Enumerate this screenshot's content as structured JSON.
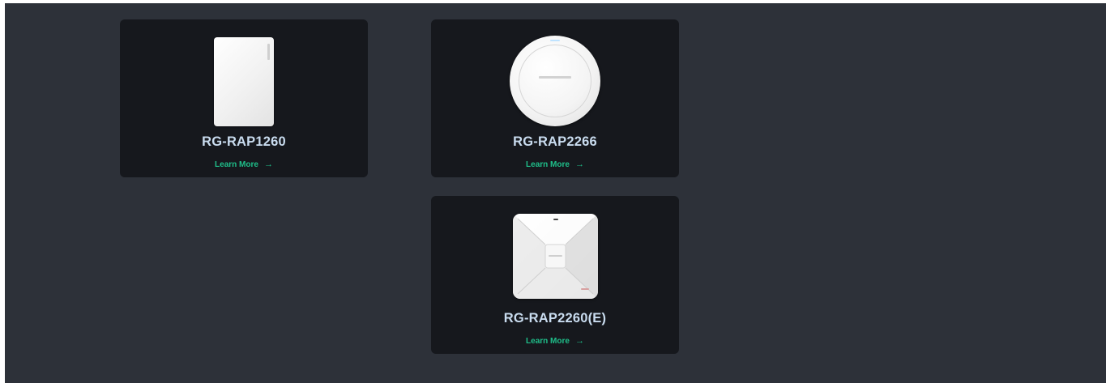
{
  "products": [
    {
      "name": "RG-RAP1260",
      "link_label": "Learn More",
      "arrow": "→",
      "image_icon": "rectangular-panel-ap"
    },
    {
      "name": "RG-RAP2266",
      "link_label": "Learn More",
      "arrow": "→",
      "image_icon": "round-ceiling-ap"
    },
    {
      "name": "RG-RAP2260(E)",
      "link_label": "Learn More",
      "arrow": "→",
      "image_icon": "square-ceiling-ap"
    }
  ],
  "colors": {
    "background": "#2d3139",
    "card": "#16181d",
    "product_name": "#c9dcef",
    "link": "#1fbf8a"
  }
}
